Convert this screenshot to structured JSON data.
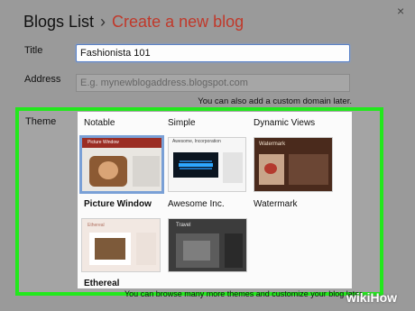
{
  "header": {
    "breadcrumb_link": "Blogs List",
    "breadcrumb_sep": "›",
    "breadcrumb_current": "Create a new blog",
    "close_glyph": "×"
  },
  "form": {
    "title_label": "Title",
    "title_value": "Fashionista 101",
    "address_label": "Address",
    "address_placeholder": "E.g. mynewblogaddress.blogspot.com",
    "address_hint": "You can also add a custom domain later.",
    "theme_label": "Theme"
  },
  "themes": [
    {
      "name": "Notable",
      "selected": true,
      "thumb_text": "Picture Window"
    },
    {
      "name": "Simple",
      "selected": false,
      "thumb_text": "Awesome, Incorporation"
    },
    {
      "name": "Dynamic Views",
      "selected": false,
      "thumb_text": "Watermark"
    },
    {
      "name": "Picture Window",
      "selected": false,
      "thumb_text": "Ethereal"
    },
    {
      "name": "Awesome Inc.",
      "selected": false,
      "thumb_text": "Travel"
    },
    {
      "name": "Watermark",
      "selected": false,
      "thumb_text": ""
    },
    {
      "name": "Ethereal",
      "selected": false
    },
    {
      "name": "Travel",
      "selected": false
    }
  ],
  "footer": {
    "browse_hint": "You can browse many more themes and customize your blog later.",
    "watermark": "wikiHow"
  },
  "colors": {
    "highlight": "#22e81c",
    "accent": "#c0392b",
    "focus": "#5a82c8"
  }
}
